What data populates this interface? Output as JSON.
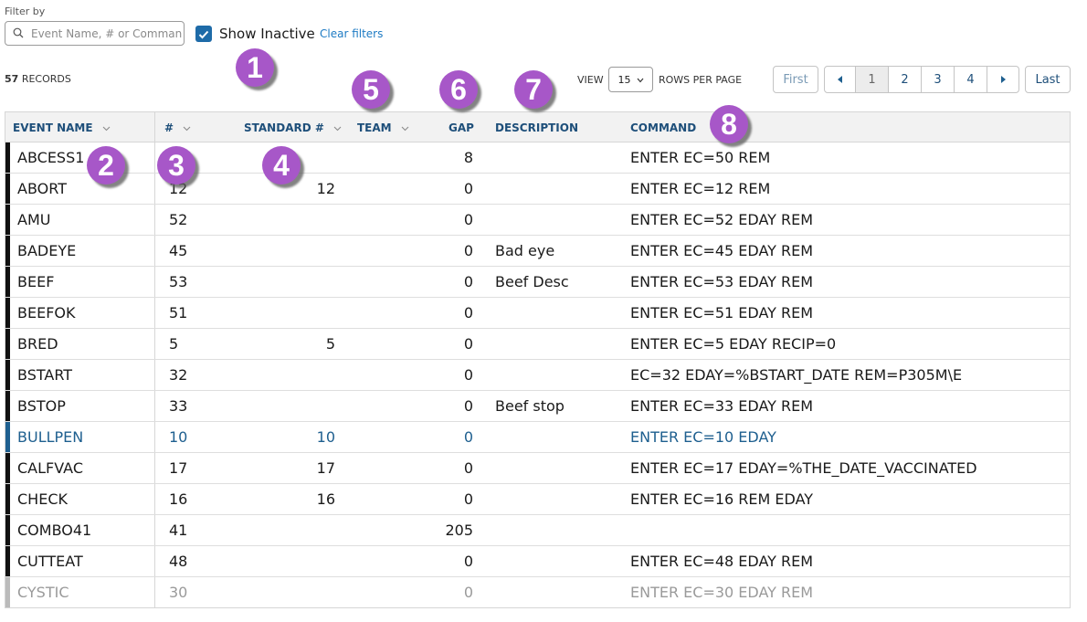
{
  "filter": {
    "label": "Filter by",
    "search_placeholder": "Event Name, # or Command",
    "show_inactive_label": "Show Inactive",
    "show_inactive_checked": true,
    "clear_filters_label": "Clear filters"
  },
  "records": {
    "count": "57",
    "label": "RECORDS"
  },
  "pagination": {
    "view_label": "VIEW",
    "rows_per_page_value": "15",
    "rows_per_page_label": "ROWS PER PAGE",
    "first_label": "First",
    "pages": [
      "1",
      "2",
      "3",
      "4"
    ],
    "current_page": "1",
    "last_label": "Last"
  },
  "table": {
    "columns": {
      "event_name": "EVENT NAME",
      "num": "#",
      "standard_num": "STANDARD #",
      "team": "TEAM",
      "gap": "GAP",
      "description": "DESCRIPTION",
      "command": "COMMAND"
    },
    "rows": [
      {
        "name": "ABCESS1",
        "num": "",
        "std": "",
        "gap": "8",
        "desc": "",
        "cmd": "ENTER EC=50 REM"
      },
      {
        "name": "ABORT",
        "num": "12",
        "std": "12",
        "gap": "0",
        "desc": "",
        "cmd": "ENTER EC=12 REM"
      },
      {
        "name": "AMU",
        "num": "52",
        "std": "",
        "gap": "0",
        "desc": "",
        "cmd": "ENTER EC=52 EDAY REM"
      },
      {
        "name": "BADEYE",
        "num": "45",
        "std": "",
        "gap": "0",
        "desc": "Bad eye",
        "cmd": "ENTER EC=45 EDAY REM"
      },
      {
        "name": "BEEF",
        "num": "53",
        "std": "",
        "gap": "0",
        "desc": "Beef Desc",
        "cmd": "ENTER EC=53 EDAY REM"
      },
      {
        "name": "BEEFOK",
        "num": "51",
        "std": "",
        "gap": "0",
        "desc": "",
        "cmd": "ENTER EC=51 EDAY REM"
      },
      {
        "name": "BRED",
        "num": "5",
        "std": "5",
        "gap": "0",
        "desc": "",
        "cmd": "ENTER EC=5 EDAY RECIP=0"
      },
      {
        "name": "BSTART",
        "num": "32",
        "std": "",
        "gap": "0",
        "desc": "",
        "cmd": "EC=32 EDAY=%BSTART_DATE REM=P305M\\E"
      },
      {
        "name": "BSTOP",
        "num": "33",
        "std": "",
        "gap": "0",
        "desc": "Beef stop",
        "cmd": "ENTER EC=33 EDAY REM"
      },
      {
        "name": "BULLPEN",
        "num": "10",
        "std": "10",
        "gap": "0",
        "desc": "",
        "cmd": "ENTER EC=10 EDAY"
      },
      {
        "name": "CALFVAC",
        "num": "17",
        "std": "17",
        "gap": "0",
        "desc": "",
        "cmd": "ENTER EC=17 EDAY=%THE_DATE_VACCINATED"
      },
      {
        "name": "CHECK",
        "num": "16",
        "std": "16",
        "gap": "0",
        "desc": "",
        "cmd": "ENTER EC=16 REM EDAY"
      },
      {
        "name": "COMBO41",
        "num": "41",
        "std": "",
        "gap": "205",
        "desc": "",
        "cmd": ""
      },
      {
        "name": "CUTTEAT",
        "num": "48",
        "std": "",
        "gap": "0",
        "desc": "",
        "cmd": "ENTER EC=48 EDAY REM"
      },
      {
        "name": "CYSTIC",
        "num": "30",
        "std": "",
        "gap": "0",
        "desc": "",
        "cmd": "ENTER EC=30 EDAY REM"
      }
    ]
  },
  "annotations": [
    "1",
    "2",
    "3",
    "4",
    "5",
    "6",
    "7",
    "8"
  ],
  "colors": {
    "accent": "#1e6ba8",
    "badge": "#a757c8",
    "header_text": "#1e4f7a",
    "link": "#1e7bc4"
  }
}
